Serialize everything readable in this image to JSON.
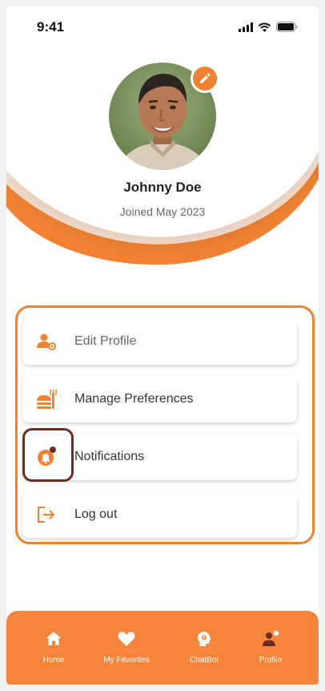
{
  "status_bar": {
    "time": "9:41"
  },
  "profile": {
    "name": "Johnny Doe",
    "joined": "Joined May 2023"
  },
  "menu": {
    "edit_profile": "Edit Profile",
    "manage_preferences": "Manage Preferences",
    "notifications": "Notifications",
    "log_out": "Log out"
  },
  "bottom_nav": {
    "home": "Home",
    "favorites": "My Favorites",
    "chatbot": "ChatBot",
    "profile": "Profile"
  },
  "colors": {
    "accent": "#f08232",
    "nav_bg": "#f5853a",
    "highlight": "#6b2e23"
  }
}
